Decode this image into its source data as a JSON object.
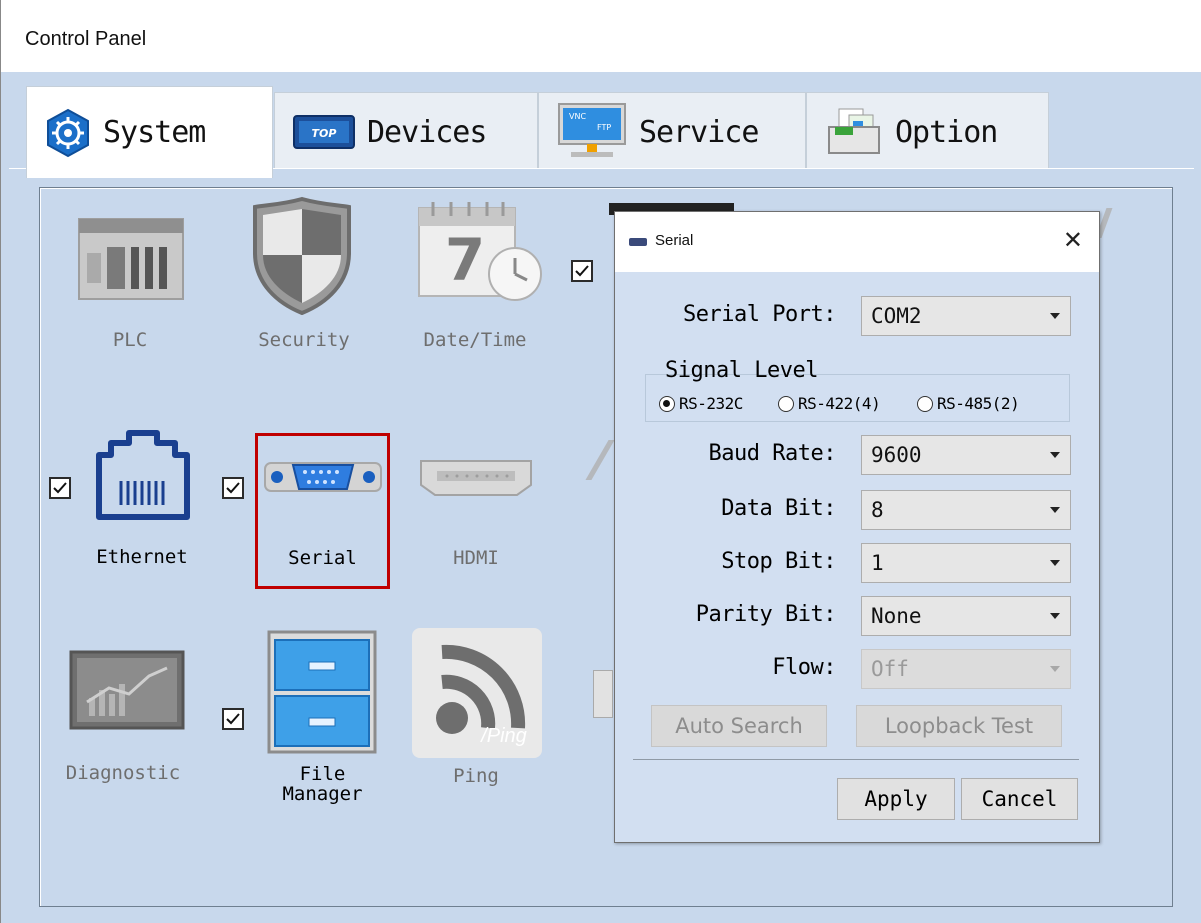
{
  "window": {
    "title": "Control Panel"
  },
  "tabs": [
    {
      "label": "System",
      "icon": "gear-icon",
      "active": true
    },
    {
      "label": "Devices",
      "icon": "top-logo-icon",
      "active": false
    },
    {
      "label": "Service",
      "icon": "vnc-ftp-monitor-icon",
      "active": false
    },
    {
      "label": "Option",
      "icon": "folder-icon",
      "active": false
    }
  ],
  "system_items": [
    {
      "label": "PLC",
      "icon": "plc-icon",
      "enabled": false
    },
    {
      "label": "Security",
      "icon": "shield-icon",
      "enabled": false
    },
    {
      "label": "Date/Time",
      "icon": "calendar-clock-icon",
      "enabled": false
    },
    {
      "label": "Ethernet",
      "icon": "ethernet-port-icon",
      "enabled": true,
      "checked": true
    },
    {
      "label": "Serial",
      "icon": "serial-port-icon",
      "enabled": true,
      "checked": true,
      "selected": true
    },
    {
      "label": "HDMI",
      "icon": "hdmi-port-icon",
      "enabled": false
    },
    {
      "label": "Diagnostic",
      "icon": "chart-monitor-icon",
      "enabled": false
    },
    {
      "label": "File\nManager",
      "label_line1": "File",
      "label_line2": "Manager",
      "icon": "file-cabinet-icon",
      "enabled": true,
      "checked": true
    },
    {
      "label": "Ping",
      "icon": "ping-icon",
      "enabled": false
    }
  ],
  "serial_dialog": {
    "title": "Serial",
    "close": "✕",
    "serial_port_label": "Serial Port:",
    "serial_port_value": "COM2",
    "signal_level_label": "Signal Level",
    "signal_options": [
      "RS-232C",
      "RS-422(4)",
      "RS-485(2)"
    ],
    "signal_selected": "RS-232C",
    "baud_rate_label": "Baud Rate:",
    "baud_rate_value": "9600",
    "data_bit_label": "Data Bit:",
    "data_bit_value": "8",
    "stop_bit_label": "Stop Bit:",
    "stop_bit_value": "1",
    "parity_bit_label": "Parity Bit:",
    "parity_bit_value": "None",
    "flow_label": "Flow:",
    "flow_value": "Off",
    "auto_search_label": "Auto Search",
    "loopback_test_label": "Loopback Test",
    "apply_label": "Apply",
    "cancel_label": "Cancel"
  },
  "colors": {
    "selection_border": "#c00000",
    "window_bg": "#c8d8ec"
  }
}
